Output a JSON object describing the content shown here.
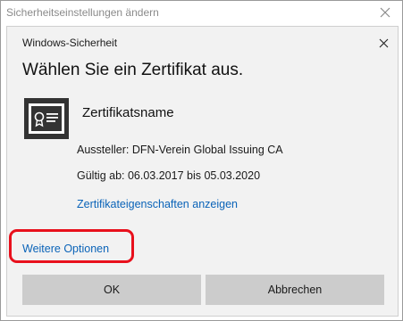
{
  "outer_window": {
    "title": "Sicherheitseinstellungen ändern"
  },
  "dialog": {
    "header_title": "Windows-Sicherheit",
    "heading": "Wählen Sie ein Zertifikat aus.",
    "certificate": {
      "name": "Zertifikatsname",
      "issuer": "Aussteller: DFN-Verein Global Issuing CA",
      "validity": "Gültig ab: 06.03.2017 bis 05.03.2020",
      "properties_link": "Zertifikateigenschaften anzeigen",
      "icon": "certificate-icon"
    },
    "more_options_link": "Weitere Optionen",
    "buttons": {
      "ok": "OK",
      "cancel": "Abbrechen"
    }
  },
  "colors": {
    "link": "#0a63b8",
    "highlight": "#e8101c",
    "dialog_background": "#f2f2f2",
    "button_background": "#cccccc"
  }
}
